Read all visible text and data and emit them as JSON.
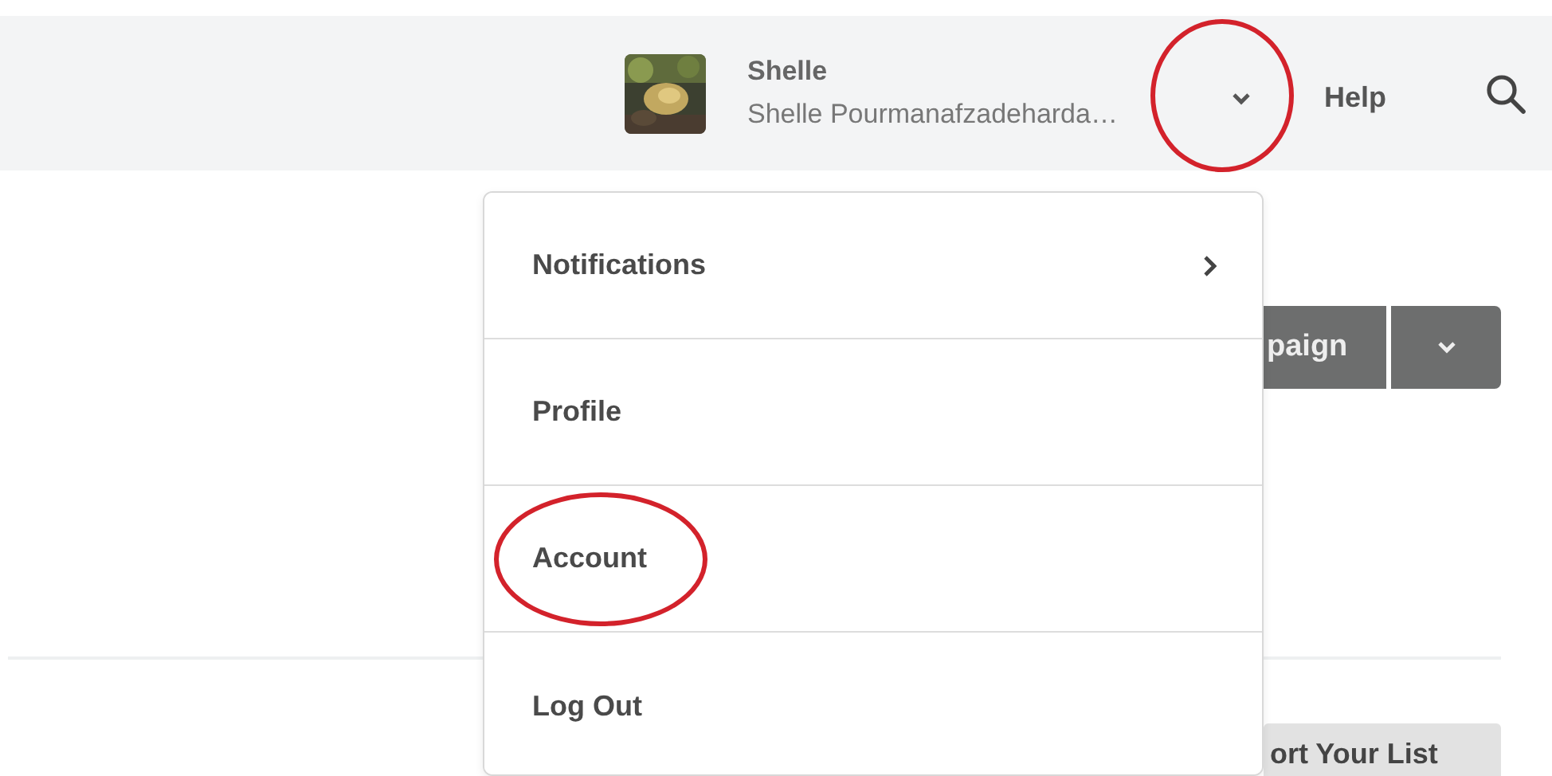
{
  "header": {
    "user": {
      "name": "Shelle",
      "full_name": "Shelle Pourmanafzadeharda…"
    },
    "menu_toggle": {
      "expanded": true,
      "highlighted": true
    },
    "help": "Help"
  },
  "dropdown": {
    "items": [
      {
        "label": "Notifications",
        "has_submenu": true,
        "highlighted": false
      },
      {
        "label": "Profile",
        "has_submenu": false,
        "highlighted": false
      },
      {
        "label": "Account",
        "has_submenu": false,
        "highlighted": true
      },
      {
        "label": "Log Out",
        "has_submenu": false,
        "highlighted": false
      }
    ]
  },
  "page": {
    "campaign_button": "paign",
    "import_button": "ort Your List"
  }
}
